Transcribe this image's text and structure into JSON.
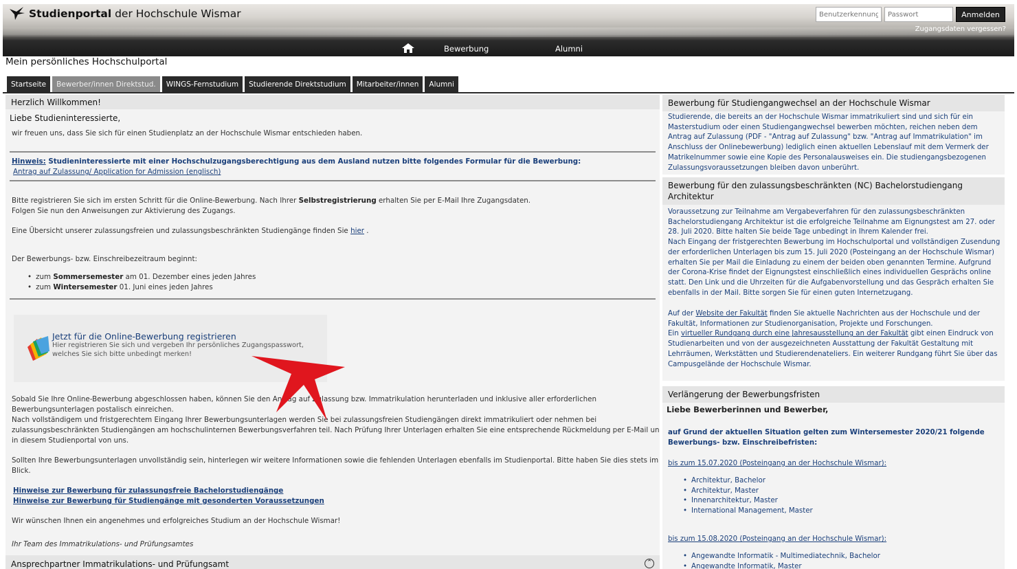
{
  "header": {
    "logo_bold": "Studienportal",
    "logo_rest": " der Hochschule Wismar",
    "username_placeholder": "Benutzerkennung",
    "password_placeholder": "Passwort",
    "login_button": "Anmelden",
    "forgot_link": "Zugangsdaten vergessen?",
    "nav": [
      "Bewerbung",
      "Alumni"
    ]
  },
  "portal_title": "Mein persönliches Hochschulportal",
  "tabs": [
    "Startseite",
    "Bewerber/innen Direktstud.",
    "WINGS-Fernstudium",
    "Studierende Direktstudium",
    "Mitarbeiter/innen",
    "Alumni"
  ],
  "left": {
    "heading": "Herzlich Willkommen!",
    "greeting": "Liebe Studieninteressierte,",
    "intro": "wir freuen uns, dass Sie sich für einen Studienplatz an der Hochschule Wismar entschieden haben.",
    "hint_label": "Hinweis:",
    "hint_text": " Studieninteressierte mit einer Hochschulzugangsberechtigung aus dem Ausland nutzen bitte folgendes Formular für die Bewerbung:",
    "hint_link": "Antrag auf Zulassung/ Application for Admission (englisch)",
    "reg_line1_a": "Bitte registrieren Sie sich im ersten Schritt für die Online-Bewerbung. Nach Ihrer ",
    "reg_line1_b": "Selbstregistrierung",
    "reg_line1_c": " erhalten Sie per E-Mail Ihre Zugangsdaten.",
    "reg_line2": "Folgen Sie nun den Anweisungen zur Aktivierung des Zugangs.",
    "overview_text": "Eine Übersicht unserer zulassungsfreien und zulassungsbeschränkten Studiengänge finden Sie",
    "overview_link": "hier",
    "period_intro": "Der Bewerbungs- bzw. Einschreibezeitraum beginnt:",
    "period_items": [
      {
        "pre": "zum ",
        "bold": "Sommersemester",
        "post": " am 01. Dezember eines jeden Jahres"
      },
      {
        "pre": "zum ",
        "bold": "Wintersemester",
        "post": " 01. Juni eines jeden Jahres"
      }
    ],
    "reg_box_title": "Jetzt für die Online-Bewerbung registrieren",
    "reg_box_sub1": "Hier registrieren Sie sich und vergeben Ihr persönliches Zugangspasswort,",
    "reg_box_sub2": "welches Sie sich bitte unbedingt merken!",
    "para1": [
      "Sobald Sie Ihre Online-Bewerbung abgeschlossen haben, können Sie den Antrag auf Zulassung bzw. Immatrikulation herunterladen und inklusive aller erforderlichen",
      "Bewerbungsunterlagen postalisch einreichen.",
      "Nach vollständigem und fristgerechtem Eingang Ihrer Bewerbungsunterlagen werden Sie bei zulassungsfreien Studiengängen direkt immatrikuliert oder nehmen bei",
      "zulassungsbeschränkten Studiengängen am hochschulinternen Bewerbungsverfahren teil. Nach Prüfung Ihrer Unterlagen erhalten Sie eine entsprechende Rückmeldung per E-Mail und",
      "in diesem Studienportal von uns."
    ],
    "para2": [
      "Sollten Ihre Bewerbungsunterlagen unvollständig sein, hinterlegen wir weitere Informationen sowie die fehlenden Unterlagen ebenfalls im Studienportal. Bitte haben Sie dies stets im",
      "Blick."
    ],
    "links": [
      "Hinweise zur Bewerbung für zulassungsfreie Bachelorstudiengänge",
      "Hinweise zur Bewerbung für Studiengänge mit gesonderten Voraussetzungen"
    ],
    "wish": "Wir wünschen Ihnen ein angenehmes und erfolgreiches Studium an der Hochschule Wismar!",
    "signature": "Ihr Team des Immatrikulations- und Prüfungsamtes",
    "bottom_heading": "Ansprechpartner Immatrikulations- und Prüfungsamt"
  },
  "right": {
    "block1": {
      "heading": "Bewerbung für Studiengangwechsel an der Hochschule Wismar",
      "lines": [
        "Studierende, die bereits an der Hochschule Wismar immatrikuliert sind und sich für ein",
        "Masterstudium oder einen Studiengangwechsel bewerben möchten, reichen neben dem",
        "Antrag auf Zulassung (PDF - \"Antrag auf Zulassung\" bzw. \"Antrag auf Immatrikulation\" im",
        "Anschluss der Onlinebewerbung) lediglich einen aktuellen Lebenslauf mit dem Vermerk der",
        "Matrikelnummer sowie eine Kopie des Personalausweises ein. Die studiengangsbezogenen",
        "Zulassungsvoraussetzungen bleiben davon unberührt."
      ]
    },
    "block2": {
      "heading1": "Bewerbung für den zulassungsbeschränkten (NC) Bachelorstudiengang",
      "heading2": "Architektur",
      "lines": [
        "Voraussetzung zur Teilnahme am Vergabeverfahren für den zulassungsbeschränkten",
        "Bachelorstudiengang Architektur ist die erfolgreiche Teilnahme am Eignungstest am 27. oder",
        "28. Juli 2020. Bitte halten Sie beide Tage unbedingt in Ihrem Kalender frei.",
        "Nach Eingang der fristgerechten Bewerbung im Hochschulportal und vollständigen Zusendung",
        "der erforderlichen Unterlagen bis zum 15. Juli 2020 (Posteingang an der Hochschule Wismar)",
        "erhalten Sie per Mail die Einladung zu einem der beiden oben genannten Termine. Aufgrund",
        "der Corona-Krise findet der Eignungstest einschließlich eines individuellen Gesprächs online",
        "statt. Den Link und die Uhrzeiten für die Aufgabenvorstellung und das Gespräch erhalten Sie",
        "ebenfalls in der Mail. Bitte sorgen Sie für einen guten Internetzugang."
      ],
      "fak_pre": "Auf der ",
      "fak_link": "Website der Fakultät",
      "fak_post": " finden Sie aktuelle Nachrichten aus der Hochschule und der",
      "fak_line2": "Fakultät, Informationen zur Studienorganisation, Projekte und Forschungen.",
      "tour_pre": "Ein ",
      "tour_link": "virtueller Rundgang durch eine Jahresausstellung an der Fakultät",
      "tour_post": " gibt einen Eindruck von",
      "tour_lines": [
        "Studienarbeiten und von der ausgezeichneten Ausstattung der Fakultät Gestaltung mit",
        "Lehrräumen, Werkstätten und Studierendenateliers. Ein weiterer Rundgang führt Sie über das",
        "Campusgelände der Hochschule Wismar."
      ]
    },
    "block3": {
      "heading": "Verlängerung der Bewerbungsfristen",
      "greeting": "Liebe Bewerberinnen und Bewerber,",
      "bold1": "auf Grund der aktuellen Situation gelten zum Wintersemester 2020/21 folgende",
      "bold2": "Bewerbungs- bzw. Einschreibefristen:",
      "date1": "bis zum 15.07.2020 (Posteingang an der Hochschule Wismar):",
      "list1": [
        "Architektur, Bachelor",
        "Architektur, Master",
        "Innenarchitektur, Master",
        "International Management, Master"
      ],
      "date2": "bis zum 15.08.2020 (Posteingang an der Hochschule Wismar):",
      "list2": [
        "Angewandte Informatik - Multimediatechnik, Bachelor",
        "Angewandte Informatik, Master"
      ]
    }
  },
  "colors": {
    "nav_dark": "#1b1b1b",
    "tab_active": "#8a8a8a",
    "link_blue": "#1a3f7a",
    "panel_bg": "#f3f3f3",
    "arrow_red": "#e0161e"
  }
}
